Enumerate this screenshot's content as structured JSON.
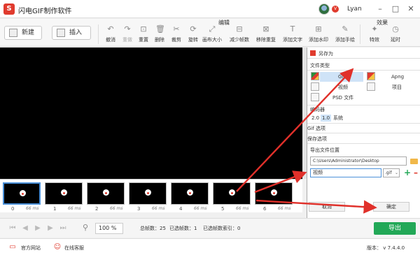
{
  "app": {
    "title": "闪电GIF制作软件",
    "logo_text": "S",
    "user_name": "Lyan",
    "vip_text": "V"
  },
  "window": {
    "minimize": "–",
    "maximize": "□",
    "close": "✕"
  },
  "toolbar": {
    "new_label": "新建",
    "insert_label": "插入",
    "edit_section": "编辑",
    "effects_section": "效果",
    "tools": [
      {
        "label": "撤消",
        "icon": "↶",
        "dim": false
      },
      {
        "label": "重做",
        "icon": "↷",
        "dim": true
      },
      {
        "label": "重置",
        "icon": "⊡",
        "dim": false
      },
      {
        "label": "删除",
        "icon": "🗑",
        "dim": false
      },
      {
        "label": "裁剪",
        "icon": "✂",
        "dim": false
      },
      {
        "label": "旋转",
        "icon": "⟳",
        "dim": false
      },
      {
        "label": "画布大小",
        "icon": "⤢",
        "dim": false
      },
      {
        "label": "减少帧数",
        "icon": "⊟",
        "dim": false
      },
      {
        "label": "移除重复",
        "icon": "⊠",
        "dim": false
      },
      {
        "label": "添加文字",
        "icon": "T",
        "dim": false
      },
      {
        "label": "添加水印",
        "icon": "⊞",
        "dim": false
      },
      {
        "label": "添加手绘",
        "icon": "✎",
        "dim": false
      },
      {
        "label": "特效",
        "icon": "✦",
        "dim": false
      },
      {
        "label": "延时",
        "icon": "◷",
        "dim": false
      }
    ]
  },
  "filmstrip": {
    "frames": [
      {
        "index": "0",
        "ms": "66 ms",
        "selected": true
      },
      {
        "index": "1",
        "ms": "66 ms",
        "selected": false
      },
      {
        "index": "2",
        "ms": "66 ms",
        "selected": false
      },
      {
        "index": "3",
        "ms": "66 ms",
        "selected": false
      },
      {
        "index": "4",
        "ms": "66 ms",
        "selected": false
      },
      {
        "index": "5",
        "ms": "66 ms",
        "selected": false
      },
      {
        "index": "6",
        "ms": "66 ms",
        "selected": false
      }
    ]
  },
  "controls": {
    "zoom": "100 %",
    "total_frames": "总帧数：25",
    "selected_frames": "已选帧数：1",
    "selected_index": "已选帧数索引：0",
    "export_label": "导出"
  },
  "footer": {
    "website": "官方网站",
    "support": "在线客服",
    "version": "版本： v 7.4.4.0"
  },
  "dialog": {
    "title": "另存为",
    "file_type_head": "文件类型",
    "file_types": {
      "gif": "Gif",
      "apng": "Apng",
      "video": "视频",
      "project": "项目",
      "psd": "PSD 文件"
    },
    "encoder_head": "编码器",
    "encoders": {
      "v20": "2.0",
      "v10": "1.0",
      "system": "系统"
    },
    "gif_options": "Gif 选项",
    "save_options": "保存选项",
    "export_location": "导出文件位置",
    "path": "C:\\Users\\Administrator\\Desktop",
    "file_name": "视频",
    "extension": ".gif",
    "cancel": "取消",
    "ok": "确定"
  },
  "colors": {
    "brand": "#e03b2e",
    "accent": "#4a90d9",
    "export_green": "#22a857",
    "arrow_red": "#e0302a"
  }
}
